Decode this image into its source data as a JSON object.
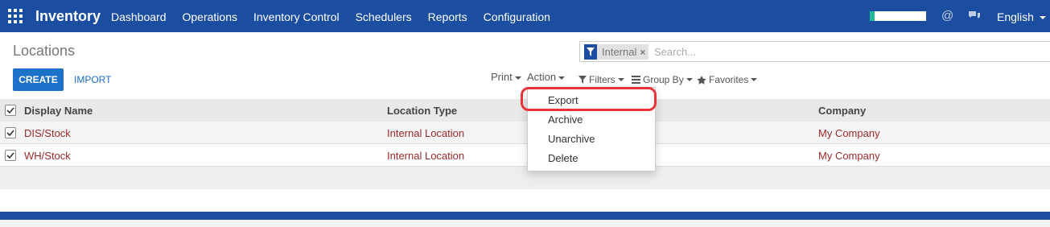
{
  "navbar": {
    "app_name": "Inventory",
    "menu": [
      "Dashboard",
      "Operations",
      "Inventory Control",
      "Schedulers",
      "Reports",
      "Configuration"
    ],
    "language": "English",
    "accent": "#1b4ea1"
  },
  "control_panel": {
    "title": "Locations",
    "create_label": "CREATE",
    "import_label": "IMPORT",
    "print_label": "Print",
    "action_label": "Action",
    "filters_label": "Filters",
    "groupby_label": "Group By",
    "favorites_label": "Favorites",
    "search": {
      "facet": "Internal",
      "placeholder": "Search..."
    }
  },
  "table": {
    "columns": [
      "Display Name",
      "Location Type",
      "Company"
    ],
    "rows": [
      {
        "display_name": "DIS/Stock",
        "location_type": "Internal Location",
        "company": "My Company",
        "checked": true
      },
      {
        "display_name": "WH/Stock",
        "location_type": "Internal Location",
        "company": "My Company",
        "checked": true
      }
    ]
  },
  "action_menu": {
    "items": [
      "Export",
      "Archive",
      "Unarchive",
      "Delete"
    ],
    "highlighted": "Export",
    "highlight_color": "#e8333a"
  }
}
